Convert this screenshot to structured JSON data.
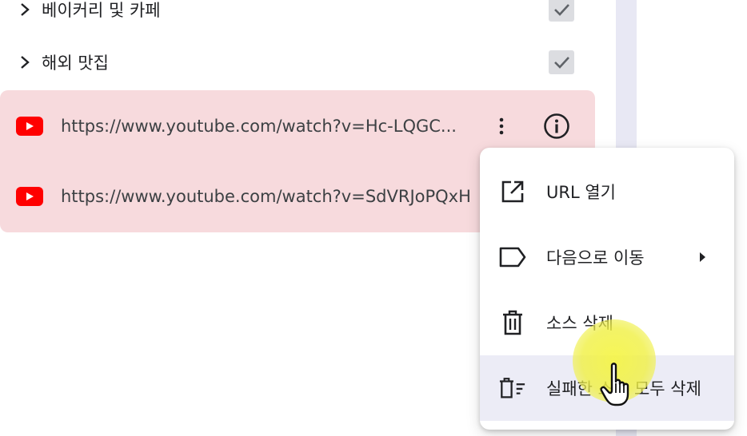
{
  "folders": [
    {
      "label": "베이커리 및 카페",
      "checked": true
    },
    {
      "label": "해외 맛집",
      "checked": true
    }
  ],
  "sources": [
    {
      "icon": "youtube-icon",
      "url": "https://www.youtube.com/watch?v=Hc-LQGC..."
    },
    {
      "icon": "youtube-icon",
      "url": "https://www.youtube.com/watch?v=SdVRJoPQxH"
    }
  ],
  "context_menu": {
    "items": [
      {
        "icon": "open-in-new-icon",
        "label": "URL 열기"
      },
      {
        "icon": "label-tag-icon",
        "label": "다음으로 이동",
        "has_submenu": true
      },
      {
        "icon": "trash-icon",
        "label": "소스 삭제"
      },
      {
        "icon": "delete-sweep-icon",
        "label": "실패한 소스 모두 삭제",
        "hovered": true
      }
    ]
  },
  "colors": {
    "selected_group_bg": "#f7dadd",
    "youtube_red": "#ff0000",
    "menu_hover_bg": "#ececf6",
    "cursor_highlight": "#f5f53c"
  }
}
